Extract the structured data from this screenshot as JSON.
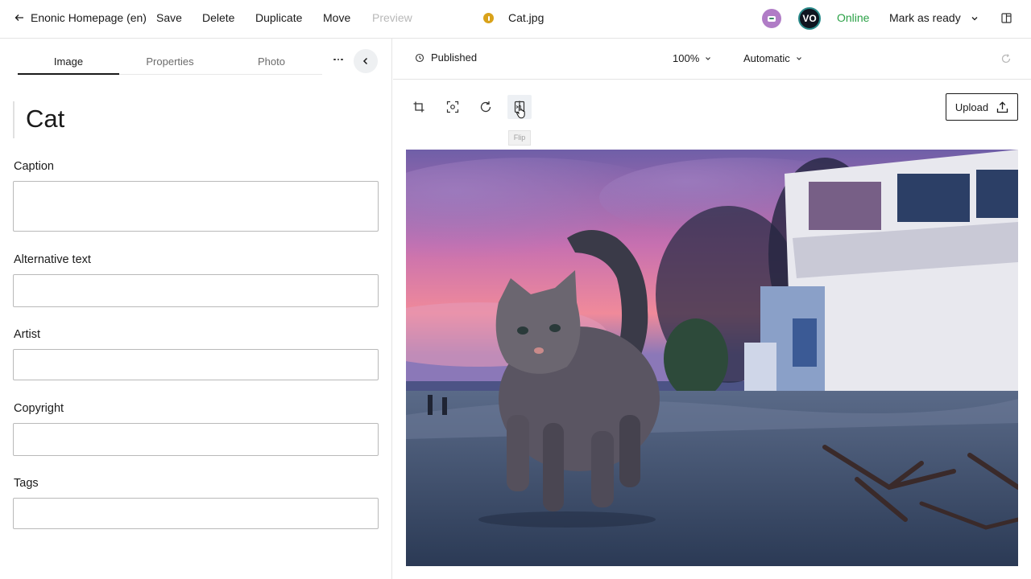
{
  "topbar": {
    "back_label": "Enonic Homepage (en)",
    "save": "Save",
    "delete": "Delete",
    "duplicate": "Duplicate",
    "move": "Move",
    "preview": "Preview",
    "file_name": "Cat.jpg",
    "user_initials": "VO",
    "status": "Online",
    "mark_as_ready": "Mark as ready"
  },
  "tabs": [
    "Image",
    "Properties",
    "Photo"
  ],
  "form": {
    "title": "Cat",
    "caption_label": "Caption",
    "alt_label": "Alternative text",
    "artist_label": "Artist",
    "copyright_label": "Copyright",
    "tags_label": "Tags"
  },
  "editor": {
    "publish_status": "Published",
    "zoom": "100%",
    "mode": "Automatic",
    "upload": "Upload",
    "tooltip": "Flip"
  },
  "colors": {
    "online": "#2aa146",
    "warning": "#d9a21a",
    "bot_avatar": "#b07cc6"
  }
}
